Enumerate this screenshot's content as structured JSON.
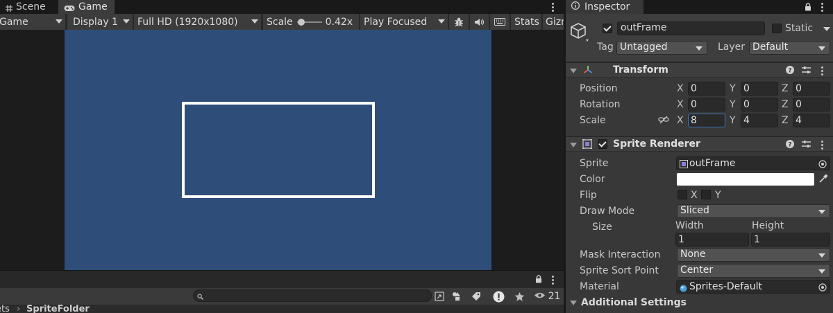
{
  "left_tabs": [
    {
      "label": "Scene",
      "icon": "grid-icon"
    },
    {
      "label": "Game",
      "icon": "gamepad-icon"
    }
  ],
  "game_toolbar": {
    "view_dropdown": "Game",
    "display_dropdown": "Display 1",
    "resolution_dropdown": "Full HD (1920x1080)",
    "scale_label": "Scale",
    "scale_value": "0.42x",
    "scale_fraction": 0.05,
    "play_mode_dropdown": "Play Focused",
    "stats_label": "Stats",
    "gizmos_label": "Gizm"
  },
  "game_view": {
    "background_color": "#2f4d79",
    "frame_color": "#ffffff"
  },
  "project_panel": {
    "search_placeholder": "",
    "hidden_count": "21",
    "breadcrumb": [
      "ets",
      "SpriteFolder"
    ]
  },
  "inspector": {
    "tab_label": "Inspector",
    "object_name": "outFrame",
    "active": true,
    "static_label": "Static",
    "static_checked": false,
    "tag_label": "Tag",
    "tag_value": "Untagged",
    "layer_label": "Layer",
    "layer_value": "Default",
    "transform": {
      "title": "Transform",
      "rows": [
        {
          "label": "Position",
          "x": "0",
          "y": "0",
          "z": "0"
        },
        {
          "label": "Rotation",
          "x": "0",
          "y": "0",
          "z": "0"
        },
        {
          "label": "Scale",
          "x": "8",
          "y": "4",
          "z": "4"
        }
      ]
    },
    "sprite_renderer": {
      "title": "Sprite Renderer",
      "enabled": true,
      "sprite_label": "Sprite",
      "sprite_value": "outFrame",
      "color_label": "Color",
      "color_value": "#ffffff",
      "flip_label": "Flip",
      "flip_x_label": "X",
      "flip_y_label": "Y",
      "draw_mode_label": "Draw Mode",
      "draw_mode_value": "Sliced",
      "size_label": "Size",
      "width_label": "Width",
      "height_label": "Height",
      "width_value": "1",
      "height_value": "1",
      "mask_label": "Mask Interaction",
      "mask_value": "None",
      "sort_point_label": "Sprite Sort Point",
      "sort_point_value": "Center",
      "material_label": "Material",
      "material_value": "Sprites-Default"
    },
    "additional_settings_label": "Additional Settings"
  },
  "axis_labels": {
    "x": "X",
    "y": "Y",
    "z": "Z"
  },
  "colors": {
    "accent_focus": "#3a79bb",
    "panel_bg": "#383838"
  }
}
